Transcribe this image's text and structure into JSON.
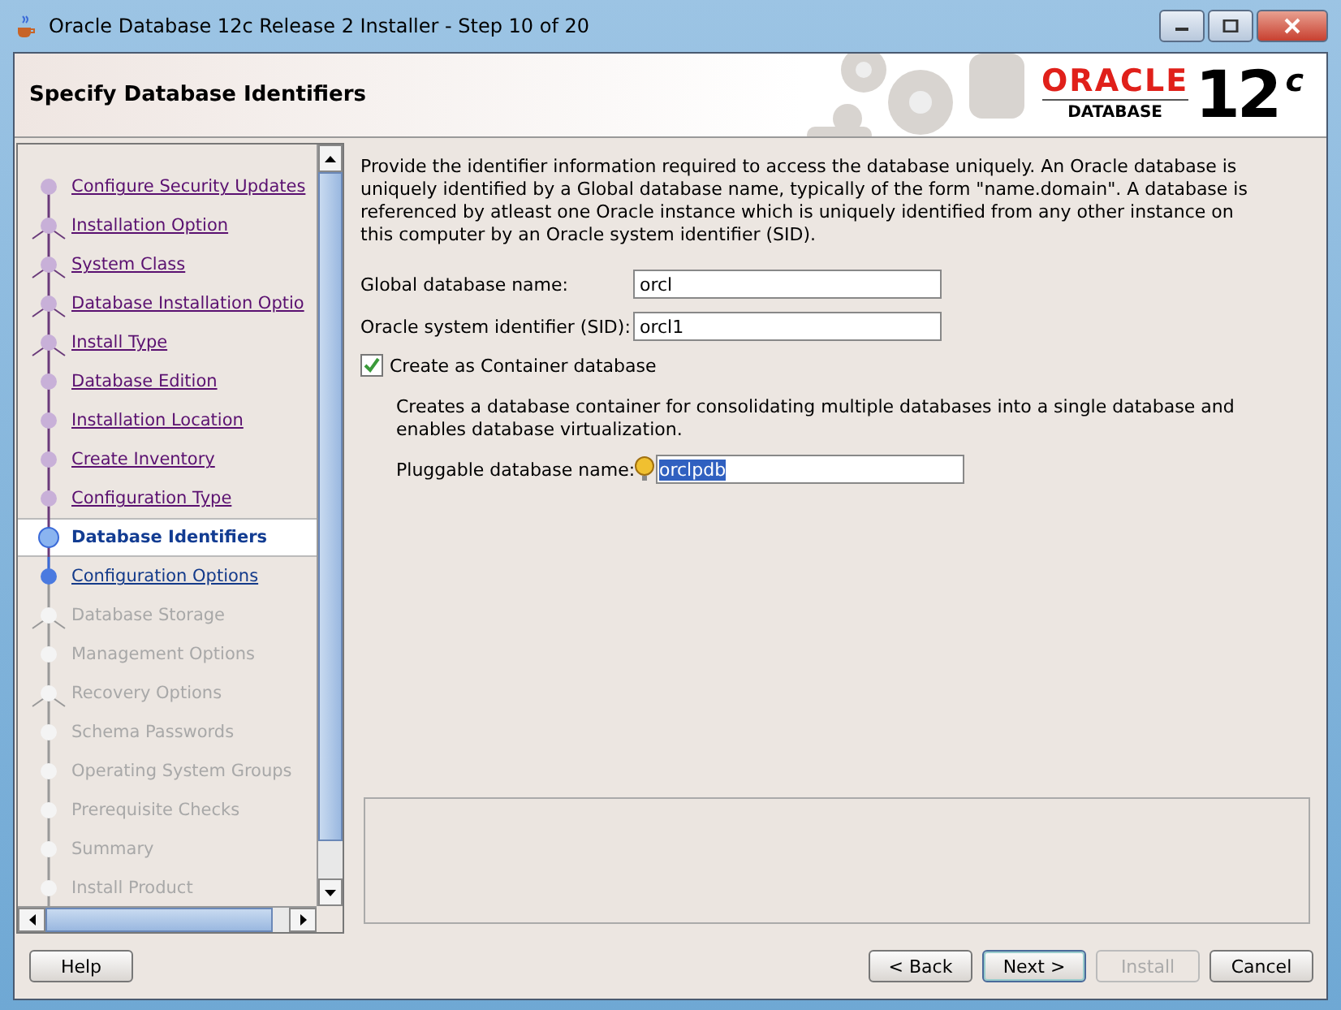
{
  "window": {
    "title": "Oracle Database 12c Release 2 Installer - Step 10 of 20"
  },
  "header": {
    "title": "Specify Database Identifiers",
    "logo": {
      "brand": "ORACLE",
      "product": "DATABASE",
      "version": "12",
      "suffix": "c"
    }
  },
  "steps": [
    {
      "label": "Configure Security Updates",
      "kind": "done",
      "branch": false
    },
    {
      "label": "Installation Option",
      "kind": "done",
      "branch": true
    },
    {
      "label": "System Class",
      "kind": "done",
      "branch": true
    },
    {
      "label": "Database Installation Optio",
      "kind": "done",
      "branch": true
    },
    {
      "label": "Install Type",
      "kind": "done",
      "branch": true
    },
    {
      "label": "Database Edition",
      "kind": "done",
      "branch": false
    },
    {
      "label": "Installation Location",
      "kind": "done",
      "branch": false
    },
    {
      "label": "Create Inventory",
      "kind": "done",
      "branch": false
    },
    {
      "label": "Configuration Type",
      "kind": "done",
      "branch": false
    },
    {
      "label": "Database Identifiers",
      "kind": "current",
      "branch": false
    },
    {
      "label": "Configuration Options",
      "kind": "next",
      "branch": false
    },
    {
      "label": "Database Storage",
      "kind": "pending",
      "branch": true
    },
    {
      "label": "Management Options",
      "kind": "pending",
      "branch": false
    },
    {
      "label": "Recovery Options",
      "kind": "pending",
      "branch": true
    },
    {
      "label": "Schema Passwords",
      "kind": "pending",
      "branch": false
    },
    {
      "label": "Operating System Groups",
      "kind": "pending",
      "branch": false
    },
    {
      "label": "Prerequisite Checks",
      "kind": "pending",
      "branch": false
    },
    {
      "label": "Summary",
      "kind": "pending",
      "branch": false
    },
    {
      "label": "Install Product",
      "kind": "pending",
      "branch": false
    }
  ],
  "form": {
    "intro": "Provide the identifier information required to access the database uniquely. An Oracle database is uniquely identified by a Global database name, typically of the form \"name.domain\". A database is referenced by atleast one Oracle instance which is uniquely identified from any other instance on this computer by an Oracle system identifier (SID).",
    "global_name": {
      "label": "Global database name:",
      "value": "orcl"
    },
    "sid": {
      "label": "Oracle system identifier (SID):",
      "value": "orcl1"
    },
    "container": {
      "label": "Create as Container database",
      "checked": true,
      "description": "Creates a database container for consolidating multiple databases into a single database and enables database virtualization."
    },
    "pluggable": {
      "label": "Pluggable database name:",
      "value": "orclpdb",
      "selected": true
    }
  },
  "buttons": [
    {
      "label": "Help",
      "disabled": false,
      "default": false
    },
    {
      "label": "< Back",
      "disabled": false,
      "default": false
    },
    {
      "label": "Next >",
      "disabled": false,
      "default": true
    },
    {
      "label": "Install",
      "disabled": true,
      "default": false
    },
    {
      "label": "Cancel",
      "disabled": false,
      "default": false
    }
  ]
}
